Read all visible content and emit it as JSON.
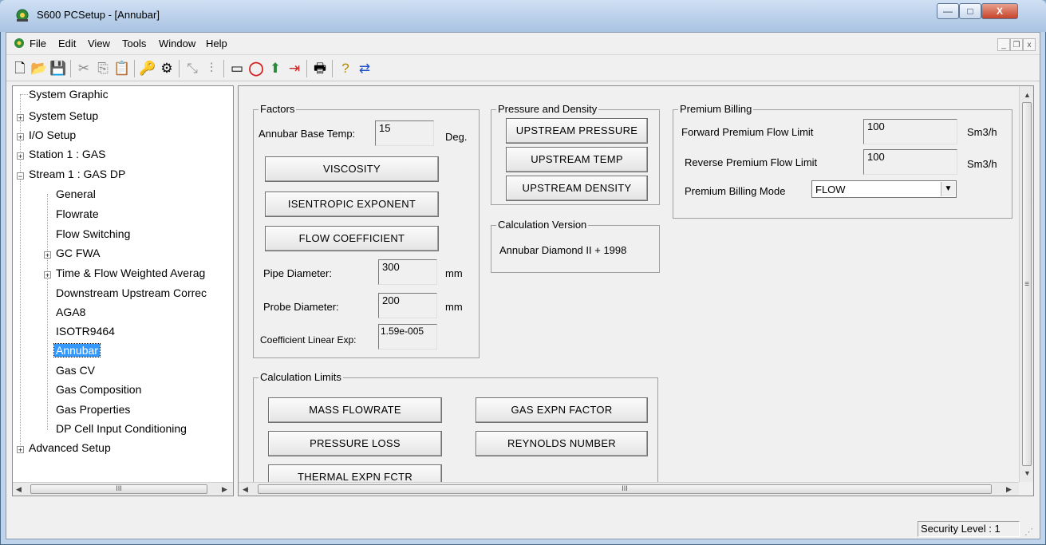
{
  "window": {
    "title": "S600 PCSetup - [Annubar]",
    "caption_minimize": "—",
    "caption_maximize": "□",
    "caption_close": "X"
  },
  "menubar": {
    "items": [
      "File",
      "Edit",
      "View",
      "Tools",
      "Window",
      "Help"
    ],
    "mdi_minimize": "_",
    "mdi_restore": "❐",
    "mdi_close": "x"
  },
  "toolbar": {
    "icons": [
      "new-icon",
      "open-icon",
      "save-icon",
      "cut-icon",
      "copy-icon",
      "paste-icon",
      "key-icon",
      "security-icon",
      "connect-icon",
      "tune-icon",
      "meter-icon",
      "stop-icon",
      "pin-icon",
      "exit-icon",
      "print-icon",
      "help-icon",
      "swap-icon"
    ]
  },
  "tree": {
    "items": [
      {
        "label": "System Graphic",
        "expander": ""
      },
      {
        "label": "System Setup",
        "expander": "+"
      },
      {
        "label": "I/O Setup",
        "expander": "+"
      },
      {
        "label": "Station 1 : GAS",
        "expander": "+"
      },
      {
        "label": "Stream 1 : GAS DP",
        "expander": "−"
      },
      {
        "label": "General",
        "expander": ""
      },
      {
        "label": "Flowrate",
        "expander": ""
      },
      {
        "label": "Flow Switching",
        "expander": ""
      },
      {
        "label": "GC FWA",
        "expander": "+"
      },
      {
        "label": "Time & Flow Weighted Averag",
        "expander": "+"
      },
      {
        "label": "Downstream Upstream Correc",
        "expander": ""
      },
      {
        "label": "AGA8",
        "expander": ""
      },
      {
        "label": "ISOTR9464",
        "expander": ""
      },
      {
        "label": "Annubar",
        "expander": "",
        "selected": true
      },
      {
        "label": "Gas CV",
        "expander": ""
      },
      {
        "label": "Gas Composition",
        "expander": ""
      },
      {
        "label": "Gas Properties",
        "expander": ""
      },
      {
        "label": "DP Cell Input Conditioning",
        "expander": ""
      },
      {
        "label": "Advanced Setup",
        "expander": "+"
      }
    ],
    "hscroll_grip": "III",
    "arrow_left": "◀",
    "arrow_right": "▶"
  },
  "factors": {
    "title": "Factors",
    "base_temp_label": "Annubar Base Temp:",
    "base_temp_value": "15",
    "base_temp_unit": "Deg.",
    "viscosity_button": "VISCOSITY",
    "isentropic_button": "ISENTROPIC EXPONENT",
    "flow_coeff_button": "FLOW COEFFICIENT",
    "pipe_diameter_label": "Pipe Diameter:",
    "pipe_diameter_value": "300",
    "pipe_diameter_unit": "mm",
    "probe_diameter_label": "Probe Diameter:",
    "probe_diameter_value": "200",
    "probe_diameter_unit": "mm",
    "coeff_linear_label": "Coefficient Linear Exp:",
    "coeff_linear_value": "1.59e-005"
  },
  "pressure_density": {
    "title": "Pressure and Density",
    "upstream_pressure": "UPSTREAM PRESSURE",
    "upstream_temp": "UPSTREAM TEMP",
    "upstream_density": "UPSTREAM DENSITY"
  },
  "calc_version": {
    "title": "Calculation Version",
    "value": "Annubar Diamond II + 1998"
  },
  "premium_billing": {
    "title": "Premium Billing",
    "forward_label": "Forward Premium Flow Limit",
    "forward_value": "100",
    "forward_unit": "Sm3/h",
    "reverse_label": "Reverse Premium Flow Limit",
    "reverse_value": "100",
    "reverse_unit": "Sm3/h",
    "mode_label": "Premium Billing Mode",
    "mode_value": "FLOW"
  },
  "calc_limits": {
    "title": "Calculation Limits",
    "mass_flowrate": "MASS FLOWRATE",
    "gas_expn_factor": "GAS EXPN FACTOR",
    "pressure_loss": "PRESSURE LOSS",
    "reynolds_number": "REYNOLDS NUMBER",
    "thermal_expn": "THERMAL EXPN FCTR"
  },
  "right_scroll": {
    "grip_h": "III",
    "grip_v": "≡",
    "arrow_up": "▲",
    "arrow_down": "▼",
    "arrow_left": "◀",
    "arrow_right": "▶"
  },
  "status": {
    "security_level": "Security Level : 1"
  }
}
